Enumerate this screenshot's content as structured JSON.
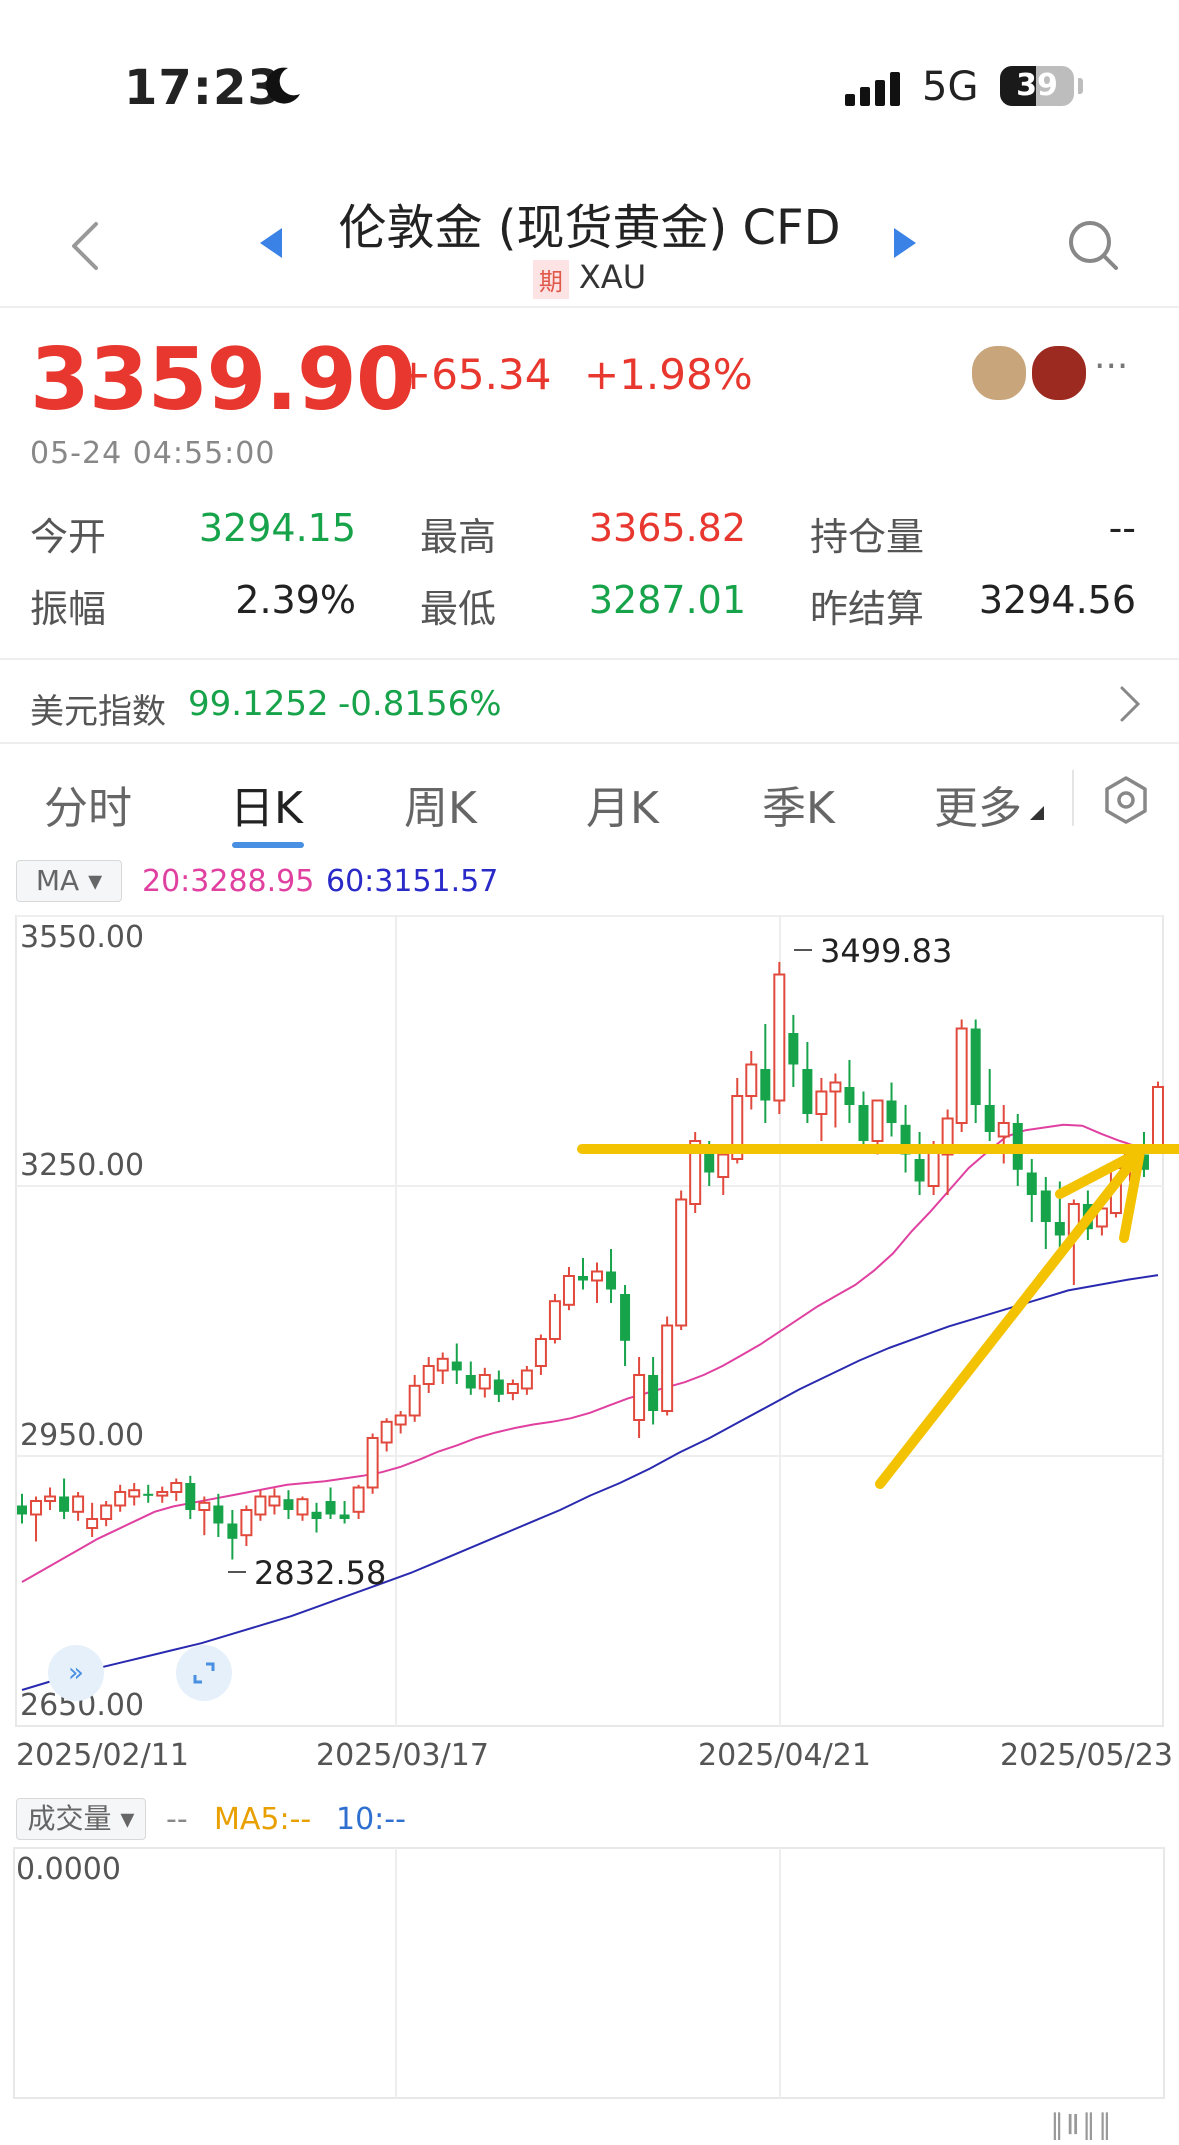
{
  "status_bar": {
    "time": "17:23",
    "network": "5G",
    "battery": "39"
  },
  "nav": {
    "title": "伦敦金 (现货黄金) CFD",
    "badge": "期",
    "symbol": "XAU"
  },
  "quote": {
    "price": "3359.90",
    "change": "+65.34",
    "change_pct": "+1.98%",
    "timestamp": "05-24 04:55:00",
    "stats": [
      {
        "label": "今开",
        "value": "3294.15"
      },
      {
        "label": "最高",
        "value": "3365.82"
      },
      {
        "label": "持仓量",
        "value": "--"
      },
      {
        "label": "振幅",
        "value": "2.39%"
      },
      {
        "label": "最低",
        "value": "3287.01"
      },
      {
        "label": "昨结算",
        "value": "3294.56"
      }
    ]
  },
  "dxy": {
    "label": "美元指数",
    "value": "99.1252",
    "change": "-0.8156%"
  },
  "tabs": [
    "分时",
    "日K",
    "周K",
    "月K",
    "季K",
    "更多"
  ],
  "active_tab": "日K",
  "ma": {
    "selector": "MA",
    "ma20": "20:3288.95",
    "ma60": "60:3151.57"
  },
  "volume": {
    "selector": "成交量",
    "value": "--",
    "ma5": "MA5:--",
    "ma10": "10:--",
    "axis_value": "0.0000"
  },
  "chart_data": {
    "type": "candlestick",
    "y_ticks": [
      "3550.00",
      "3250.00",
      "2950.00",
      "2650.00"
    ],
    "ylim": [
      2650,
      3550
    ],
    "x_ticks": [
      "2025/02/11",
      "2025/03/17",
      "2025/04/21",
      "2025/05/23"
    ],
    "annotations": {
      "high": "3499.83",
      "low": "2832.58"
    },
    "candles_ohlc": [
      [
        2895,
        2908,
        2875,
        2885
      ],
      [
        2885,
        2905,
        2855,
        2900
      ],
      [
        2900,
        2915,
        2890,
        2905
      ],
      [
        2905,
        2925,
        2880,
        2888
      ],
      [
        2888,
        2910,
        2878,
        2905
      ],
      [
        2870,
        2898,
        2860,
        2880
      ],
      [
        2880,
        2900,
        2872,
        2895
      ],
      [
        2895,
        2918,
        2888,
        2910
      ],
      [
        2905,
        2920,
        2895,
        2912
      ],
      [
        2908,
        2918,
        2898,
        2906
      ],
      [
        2906,
        2916,
        2898,
        2910
      ],
      [
        2910,
        2925,
        2900,
        2920
      ],
      [
        2920,
        2928,
        2880,
        2890
      ],
      [
        2890,
        2905,
        2862,
        2898
      ],
      [
        2895,
        2908,
        2860,
        2875
      ],
      [
        2875,
        2890,
        2835,
        2858
      ],
      [
        2862,
        2895,
        2850,
        2890
      ],
      [
        2885,
        2912,
        2878,
        2905
      ],
      [
        2895,
        2914,
        2885,
        2905
      ],
      [
        2902,
        2912,
        2880,
        2890
      ],
      [
        2885,
        2905,
        2878,
        2902
      ],
      [
        2888,
        2898,
        2865,
        2880
      ],
      [
        2900,
        2915,
        2880,
        2885
      ],
      [
        2885,
        2900,
        2875,
        2880
      ],
      [
        2888,
        2918,
        2880,
        2915
      ],
      [
        2915,
        2975,
        2908,
        2970
      ],
      [
        2965,
        2992,
        2955,
        2988
      ],
      [
        2985,
        3000,
        2975,
        2995
      ],
      [
        2995,
        3040,
        2988,
        3028
      ],
      [
        3030,
        3060,
        3020,
        3050
      ],
      [
        3045,
        3065,
        3030,
        3058
      ],
      [
        3055,
        3075,
        3030,
        3045
      ],
      [
        3040,
        3055,
        3018,
        3025
      ],
      [
        3025,
        3048,
        3015,
        3040
      ],
      [
        3035,
        3045,
        3010,
        3018
      ],
      [
        3020,
        3035,
        3012,
        3030
      ],
      [
        3025,
        3050,
        3018,
        3045
      ],
      [
        3050,
        3085,
        3040,
        3080
      ],
      [
        3080,
        3130,
        3075,
        3122
      ],
      [
        3118,
        3160,
        3112,
        3150
      ],
      [
        3150,
        3170,
        3135,
        3145
      ],
      [
        3145,
        3165,
        3120,
        3155
      ],
      [
        3155,
        3180,
        3120,
        3135
      ],
      [
        3130,
        3140,
        3050,
        3078
      ],
      [
        2990,
        3060,
        2970,
        3040
      ],
      [
        3040,
        3060,
        2985,
        3000
      ],
      [
        3000,
        3105,
        2995,
        3095
      ],
      [
        3095,
        3245,
        3090,
        3235
      ],
      [
        3230,
        3310,
        3220,
        3300
      ],
      [
        3290,
        3300,
        3250,
        3265
      ],
      [
        3260,
        3290,
        3240,
        3285
      ],
      [
        3280,
        3370,
        3275,
        3350
      ],
      [
        3350,
        3400,
        3335,
        3385
      ],
      [
        3380,
        3430,
        3320,
        3345
      ],
      [
        3345,
        3499,
        3330,
        3485
      ],
      [
        3420,
        3440,
        3360,
        3385
      ],
      [
        3380,
        3410,
        3320,
        3330
      ],
      [
        3330,
        3370,
        3300,
        3355
      ],
      [
        3355,
        3375,
        3315,
        3365
      ],
      [
        3360,
        3390,
        3320,
        3340
      ],
      [
        3340,
        3355,
        3290,
        3300
      ],
      [
        3300,
        3320,
        3285,
        3345
      ],
      [
        3345,
        3365,
        3305,
        3320
      ],
      [
        3318,
        3340,
        3265,
        3285
      ],
      [
        3280,
        3310,
        3240,
        3255
      ],
      [
        3250,
        3300,
        3240,
        3290
      ],
      [
        3285,
        3335,
        3240,
        3325
      ],
      [
        3320,
        3435,
        3310,
        3425
      ],
      [
        3425,
        3435,
        3320,
        3340
      ],
      [
        3340,
        3380,
        3300,
        3310
      ],
      [
        3305,
        3340,
        3275,
        3320
      ],
      [
        3320,
        3330,
        3250,
        3268
      ],
      [
        3265,
        3280,
        3210,
        3240
      ],
      [
        3245,
        3260,
        3180,
        3210
      ],
      [
        3210,
        3255,
        3170,
        3195
      ],
      [
        3195,
        3235,
        3140,
        3230
      ],
      [
        3230,
        3245,
        3190,
        3202
      ],
      [
        3205,
        3230,
        3195,
        3225
      ],
      [
        3220,
        3275,
        3215,
        3270
      ],
      [
        3270,
        3295,
        3255,
        3285
      ],
      [
        3285,
        3310,
        3260,
        3268
      ],
      [
        3294,
        3366,
        3287,
        3360
      ]
    ],
    "ma20_series": [
      2810,
      2822,
      2834,
      2846,
      2858,
      2868,
      2878,
      2888,
      2894,
      2898,
      2902,
      2906,
      2910,
      2914,
      2918,
      2920,
      2922,
      2925,
      2928,
      2932,
      2938,
      2946,
      2955,
      2962,
      2970,
      2976,
      2981,
      2985,
      2988,
      2992,
      2998,
      3006,
      3014,
      3020,
      3026,
      3032,
      3040,
      3050,
      3062,
      3074,
      3088,
      3102,
      3116,
      3128,
      3140,
      3156,
      3175,
      3200,
      3222,
      3246,
      3270,
      3288,
      3305,
      3312,
      3315,
      3318,
      3317,
      3308,
      3300,
      3293,
      3288
    ],
    "ma60_series": [
      2690,
      2700,
      2710,
      2718,
      2726,
      2734,
      2742,
      2752,
      2762,
      2772,
      2784,
      2796,
      2808,
      2820,
      2834,
      2848,
      2862,
      2876,
      2890,
      2906,
      2920,
      2936,
      2954,
      2970,
      2988,
      3006,
      3024,
      3040,
      3056,
      3070,
      3082,
      3094,
      3104,
      3114,
      3124,
      3134,
      3140,
      3146,
      3151
    ]
  }
}
